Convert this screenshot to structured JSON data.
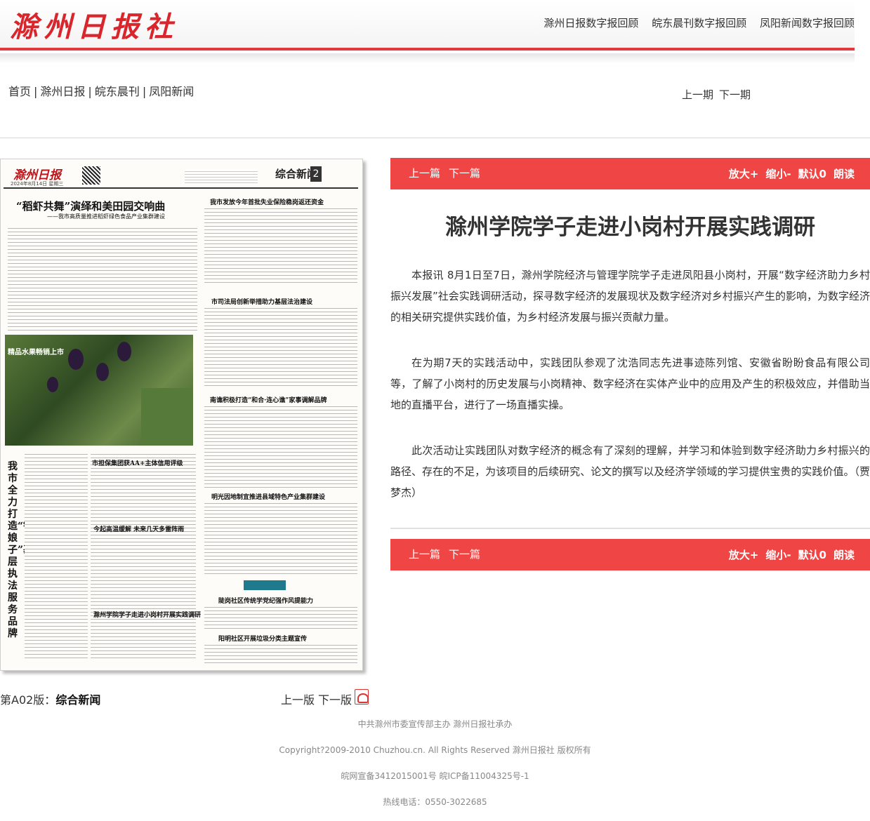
{
  "header": {
    "logo": "滁州日报社",
    "links": [
      "滁州日报数字报回顾",
      "皖东晨刊数字报回顾",
      "凤阳新闻数字报回顾"
    ]
  },
  "nav": {
    "breadcrumb": [
      "首页",
      "滁州日报",
      "皖东晨刊",
      "凤阳新闻"
    ],
    "prev_issue": "上一期",
    "next_issue": "下一期"
  },
  "newspaper": {
    "masthead_logo": "滁州日报",
    "masthead_date": "2024年8月14日  星期三",
    "section": "综合新闻",
    "page_num": "2",
    "headline": "“稻虾共舞”演绎和美田园交响曲",
    "subheadline": "——我市高质量推进稻虾绿色食品产业集群建设",
    "photo_caption": "精品水果畅销上市",
    "vertical_title": "我市全力打造“铁娘子”基层执法服务品牌",
    "headlines": [
      "我市发放今年首批失业保险稳岗返还资金",
      "市司法局创新举措助力基层法治建设",
      "南谯积极打造“和合·连心谯”家事调解品牌",
      "市担保集团获AA+主体信用评级",
      "明光因地制宜推进县域特色产业集群建设",
      "今起高温缓解 未来几天多雷阵雨",
      "滁州学院学子走进小岗村开展实践调研",
      "陡岗社区传统学党纪强作风提能力",
      "阳明社区开展垃圾分类主题宣传"
    ]
  },
  "page_footer": {
    "label_prefix": "第A02版：",
    "label_name": "综合新闻",
    "prev_page": "上一版",
    "next_page": "下一版"
  },
  "article": {
    "toolbar": {
      "prev": "上一篇",
      "next": "下一篇",
      "zoom_in": "放大+",
      "zoom_out": "缩小-",
      "default": "默认0",
      "read": "朗读"
    },
    "title": "滁州学院学子走进小岗村开展实践调研",
    "paragraphs": [
      "本报讯 8月1日至7日，滁州学院经济与管理学院学子走进凤阳县小岗村，开展“数字经济助力乡村振兴发展”社会实践调研活动，探寻数字经济的发展现状及数字经济对乡村振兴产生的影响，为数字经济的相关研究提供实践价值，为乡村经济发展与振兴贡献力量。",
      "在为期7天的实践活动中，实践团队参观了沈浩同志先进事迹陈列馆、安徽省盼盼食品有限公司等，了解了小岗村的历史发展与小岗精神、数字经济在实体产业中的应用及产生的积极效应，并借助当地的直播平台，进行了一场直播实操。",
      "此次活动让实践团队对数字经济的概念有了深刻的理解，并学习和体验到数字经济助力乡村振兴的路径、存在的不足，为该项目的后续研究、论文的撰写以及经济学领域的学习提供宝贵的实践价值。（贾梦杰）"
    ]
  },
  "footer": {
    "lines": [
      "中共滁州市委宣传部主办 滁州日报社承办",
      "Copyright?2009-2010 Chuzhou.cn. All Rights Reserved 滁州日报社 版权所有",
      "皖网宣备3412015001号 皖ICP备11004325号-1",
      "热线电话：0550-3022685"
    ]
  },
  "colors": {
    "brand_red": "#d8262c",
    "toolbar_red": "#f04545"
  }
}
